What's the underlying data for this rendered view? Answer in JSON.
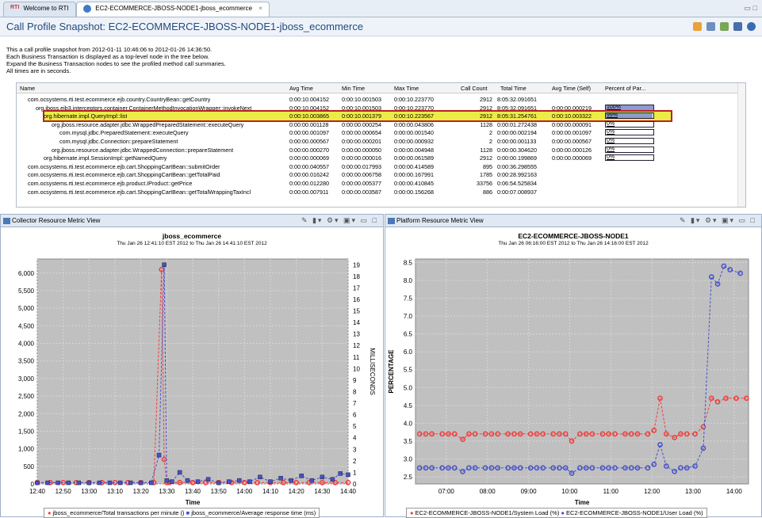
{
  "tabs": [
    {
      "label": "Welcome to RTI"
    },
    {
      "label": "EC2-ECOMMERCE-JBOSS-NODE1-jboss_ecommerce"
    }
  ],
  "header": {
    "title": "Call Profile Snapshot: EC2-ECOMMERCE-JBOSS-NODE1-jboss_ecommerce"
  },
  "description": [
    "This a call profile snapshot from 2012-01-11 10:46:06 to 2012-01-26 14:36:50.",
    "Each Business Transaction is displayed as a top-level node in the tree below.",
    "Expand the Business Transaction nodes to see the profiled method call summaries.",
    "All times are in seconds."
  ],
  "table": {
    "columns": [
      "Name",
      "Avg Time",
      "Min Time",
      "Max Time",
      "Call Count",
      "Total Time",
      "Avg Time (Self)",
      "Percent of Par..."
    ],
    "rows": [
      {
        "indent": 1,
        "name": "com.ocsystems.rti.test.ecommerce.ejb.country.CountryBean::getCountry",
        "avg": "0:00:10.004152",
        "min": "0:00:10.001503",
        "max": "0:00:10.223770",
        "count": "2912",
        "total": "8:05:32.091651",
        "self": "",
        "pct": "",
        "pctv": null
      },
      {
        "indent": 2,
        "name": "org.jboss.ejb3.interceptors.container.ContainerMethodInvocationWrapper::invokeNext",
        "avg": "0:00:10.004152",
        "min": "0:00:10.001503",
        "max": "0:00:10.223770",
        "count": "2912",
        "total": "8:05:32.091651",
        "self": "0:00:00.000219",
        "pct": "100%",
        "pctv": 100
      },
      {
        "indent": 3,
        "name": "org.hibernate.impl.QueryImpl::list",
        "avg": "0:00:10.003865",
        "min": "0:00:10.001379",
        "max": "0:00:10.223567",
        "count": "2912",
        "total": "8:05:31.254761",
        "self": "0:00:10.003322",
        "pct": "99%",
        "pctv": 99,
        "selected": true
      },
      {
        "indent": 4,
        "name": "org.jboss.resource.adapter.jdbc.WrappedPreparedStatement::executeQuery",
        "avg": "0:00:00.001128",
        "min": "0:00:00.000254",
        "max": "0:00:00.043806",
        "count": "1128",
        "total": "0:00:01.272438",
        "self": "0:00:00.000091",
        "pct": "0%",
        "pctv": 0
      },
      {
        "indent": 5,
        "name": "com.mysql.jdbc.PreparedStatement::executeQuery",
        "avg": "0:00:00.001097",
        "min": "0:00:00.000654",
        "max": "0:00:00.001540",
        "count": "2",
        "total": "0:00:00.002194",
        "self": "0:00:00.001097",
        "pct": "0%",
        "pctv": 0
      },
      {
        "indent": 5,
        "name": "com.mysql.jdbc.Connection::prepareStatement",
        "avg": "0:00:00.000567",
        "min": "0:00:00.000201",
        "max": "0:00:00.000932",
        "count": "2",
        "total": "0:00:00.001133",
        "self": "0:00:00.000567",
        "pct": "0%",
        "pctv": 0
      },
      {
        "indent": 4,
        "name": "org.jboss.resource.adapter.jdbc.WrappedConnection::prepareStatement",
        "avg": "0:00:00.000270",
        "min": "0:00:00.000050",
        "max": "0:00:00.004948",
        "count": "1128",
        "total": "0:00:00.304620",
        "self": "0:00:00.000126",
        "pct": "0%",
        "pctv": 0
      },
      {
        "indent": 3,
        "name": "org.hibernate.impl.SessionImpl::getNamedQuery",
        "avg": "0:00:00.000069",
        "min": "0:00:00.000016",
        "max": "0:00:00.061589",
        "count": "2912",
        "total": "0:00:00.199869",
        "self": "0:00:00.000069",
        "pct": "0%",
        "pctv": 0
      },
      {
        "indent": 1,
        "name": "com.ocsystems.rti.test.ecommerce.ejb.cart.ShoppingCartBean::submitOrder",
        "avg": "0:00:00.040557",
        "min": "0:00:00.017993",
        "max": "0:00:00.414589",
        "count": "895",
        "total": "0:00:36.298555",
        "self": "",
        "pct": "",
        "pctv": null
      },
      {
        "indent": 1,
        "name": "com.ocsystems.rti.test.ecommerce.ejb.cart.ShoppingCartBean::getTotalPaid",
        "avg": "0:00:00.016242",
        "min": "0:00:00.006758",
        "max": "0:00:00.167991",
        "count": "1785",
        "total": "0:00:28.992163",
        "self": "",
        "pct": "",
        "pctv": null
      },
      {
        "indent": 1,
        "name": "com.ocsystems.rti.test.ecommerce.ejb.product.IProduct::getPrice",
        "avg": "0:00:00.012280",
        "min": "0:00:00.005377",
        "max": "0:00:00.410845",
        "count": "33756",
        "total": "0:06:54.525834",
        "self": "",
        "pct": "",
        "pctv": null
      },
      {
        "indent": 1,
        "name": "com.ocsystems.rti.test.ecommerce.ejb.cart.ShoppingCartBean::getTotalWrappingTaxIncl",
        "avg": "0:00:00.007911",
        "min": "0:00:00.003587",
        "max": "0:00:00.156268",
        "count": "886",
        "total": "0:00:07.008937",
        "self": "",
        "pct": "",
        "pctv": null
      }
    ]
  },
  "left_panel": {
    "tab_label": "Collector Resource Metric View"
  },
  "right_panel": {
    "tab_label": "Platform Resource Metric View"
  },
  "chart_data": [
    {
      "type": "line",
      "title": "jboss_ecommerce",
      "subtitle": "Thu Jan 26 12:41:10 EST 2012 to Thu Jan 26 14:41:10 EST 2012",
      "xlabel": "Time",
      "ylabel": "",
      "y2label": "MILLISECONDS",
      "x_ticks": [
        "12:40",
        "12:50",
        "13:00",
        "13:10",
        "13:20",
        "13:30",
        "13:40",
        "13:50",
        "14:00",
        "14:10",
        "14:20",
        "14:30",
        "14:40"
      ],
      "x_range": [
        0,
        120
      ],
      "y_ticks": [
        "0",
        "500",
        "1,000",
        "1,500",
        "2,000",
        "2,500",
        "3,000",
        "3,500",
        "4,000",
        "4,500",
        "5,000",
        "5,500",
        "6,000"
      ],
      "ylim": [
        0,
        6400
      ],
      "y2_ticks": [
        "0",
        "1",
        "2",
        "3",
        "4",
        "5",
        "6",
        "7",
        "8",
        "9",
        "10",
        "11",
        "12",
        "13",
        "14",
        "15",
        "16",
        "17",
        "18",
        "19"
      ],
      "y2lim": [
        0,
        19.5
      ],
      "series": [
        {
          "name": "jboss_ecommerce/Total transactions per minute ()",
          "color": "#f03c3c",
          "marker": "circle",
          "axis": "left",
          "x": [
            0,
            5,
            10,
            15,
            20,
            25,
            30,
            35,
            40,
            45,
            48,
            49,
            50,
            51,
            55,
            60,
            65,
            70,
            75,
            80,
            85,
            90,
            95,
            100,
            105,
            110,
            115,
            120
          ],
          "y": [
            40,
            40,
            40,
            40,
            40,
            40,
            40,
            40,
            40,
            40,
            6100,
            700,
            40,
            40,
            40,
            40,
            40,
            40,
            40,
            40,
            40,
            40,
            40,
            40,
            40,
            40,
            40,
            40
          ]
        },
        {
          "name": "jboss_ecommerce/Average response time (ms)",
          "color": "#4650c8",
          "marker": "square",
          "axis": "right",
          "x": [
            0,
            4,
            8,
            12,
            16,
            20,
            24,
            28,
            32,
            36,
            40,
            44,
            47,
            49,
            50,
            52,
            55,
            58,
            62,
            66,
            70,
            74,
            78,
            82,
            86,
            90,
            94,
            98,
            102,
            106,
            110,
            114,
            117,
            120
          ],
          "y": [
            0.1,
            0.1,
            0.1,
            0.1,
            0.1,
            0.1,
            0.1,
            0.1,
            0.1,
            0.1,
            0.1,
            0.1,
            2.5,
            19,
            0.3,
            0.2,
            1.0,
            0.3,
            0.2,
            0.4,
            0.1,
            0.2,
            0.3,
            0.2,
            0.6,
            0.2,
            0.5,
            0.3,
            0.7,
            0.3,
            0.6,
            0.4,
            0.9,
            0.8
          ]
        }
      ]
    },
    {
      "type": "line",
      "title": "EC2-ECOMMERCE-JBOSS-NODE1",
      "subtitle": "Thu Jan 26 06:16:00 EST 2012 to Thu Jan 26 14:16:00 EST 2012",
      "xlabel": "Time",
      "ylabel": "PERCENTAGE",
      "x_ticks": [
        "07:00",
        "08:00",
        "09:00",
        "10:00",
        "11:00",
        "12:00",
        "13:00",
        "14:00"
      ],
      "x_range": [
        6.25,
        14.35
      ],
      "y_ticks": [
        "2.5",
        "3.0",
        "3.5",
        "4.0",
        "4.5",
        "5.0",
        "5.5",
        "6.0",
        "6.5",
        "7.0",
        "7.5",
        "8.0",
        "8.5"
      ],
      "ylim": [
        2.3,
        8.6
      ],
      "series": [
        {
          "name": "EC2-ECOMMERCE-JBOSS-NODE1/System Load (%)",
          "color": "#f03c3c",
          "marker": "circle",
          "x": [
            6.35,
            6.5,
            6.65,
            6.9,
            7.05,
            7.2,
            7.4,
            7.55,
            7.7,
            7.95,
            8.1,
            8.25,
            8.5,
            8.65,
            8.8,
            9.05,
            9.2,
            9.35,
            9.6,
            9.75,
            9.9,
            10.05,
            10.25,
            10.4,
            10.55,
            10.8,
            10.95,
            11.1,
            11.35,
            11.5,
            11.65,
            11.9,
            12.05,
            12.2,
            12.35,
            12.55,
            12.7,
            12.85,
            13.05,
            13.25,
            13.45,
            13.6,
            13.8,
            14.05,
            14.3
          ],
          "y": [
            3.7,
            3.7,
            3.7,
            3.7,
            3.7,
            3.7,
            3.55,
            3.7,
            3.7,
            3.7,
            3.7,
            3.7,
            3.7,
            3.7,
            3.7,
            3.7,
            3.7,
            3.7,
            3.7,
            3.7,
            3.7,
            3.5,
            3.7,
            3.7,
            3.7,
            3.7,
            3.7,
            3.7,
            3.7,
            3.7,
            3.7,
            3.7,
            3.8,
            4.7,
            3.7,
            3.6,
            3.7,
            3.7,
            3.7,
            3.9,
            4.7,
            4.6,
            4.7,
            4.7,
            4.7
          ]
        },
        {
          "name": "EC2-ECOMMERCE-JBOSS-NODE1/User Load (%)",
          "color": "#4650c8",
          "marker": "circle",
          "x": [
            6.35,
            6.5,
            6.65,
            6.9,
            7.05,
            7.2,
            7.4,
            7.55,
            7.7,
            7.95,
            8.1,
            8.25,
            8.5,
            8.65,
            8.8,
            9.05,
            9.2,
            9.35,
            9.6,
            9.75,
            9.9,
            10.05,
            10.25,
            10.4,
            10.55,
            10.8,
            10.95,
            11.1,
            11.35,
            11.5,
            11.65,
            11.9,
            12.05,
            12.2,
            12.35,
            12.55,
            12.7,
            12.85,
            13.05,
            13.25,
            13.45,
            13.6,
            13.75,
            13.9,
            14.15
          ],
          "y": [
            2.75,
            2.75,
            2.75,
            2.75,
            2.75,
            2.75,
            2.65,
            2.75,
            2.75,
            2.75,
            2.75,
            2.75,
            2.75,
            2.75,
            2.75,
            2.75,
            2.75,
            2.75,
            2.75,
            2.75,
            2.75,
            2.6,
            2.75,
            2.75,
            2.75,
            2.75,
            2.75,
            2.75,
            2.75,
            2.75,
            2.75,
            2.75,
            2.85,
            3.4,
            2.8,
            2.65,
            2.75,
            2.75,
            2.8,
            3.3,
            8.1,
            7.9,
            8.4,
            8.3,
            8.2
          ]
        }
      ]
    }
  ]
}
